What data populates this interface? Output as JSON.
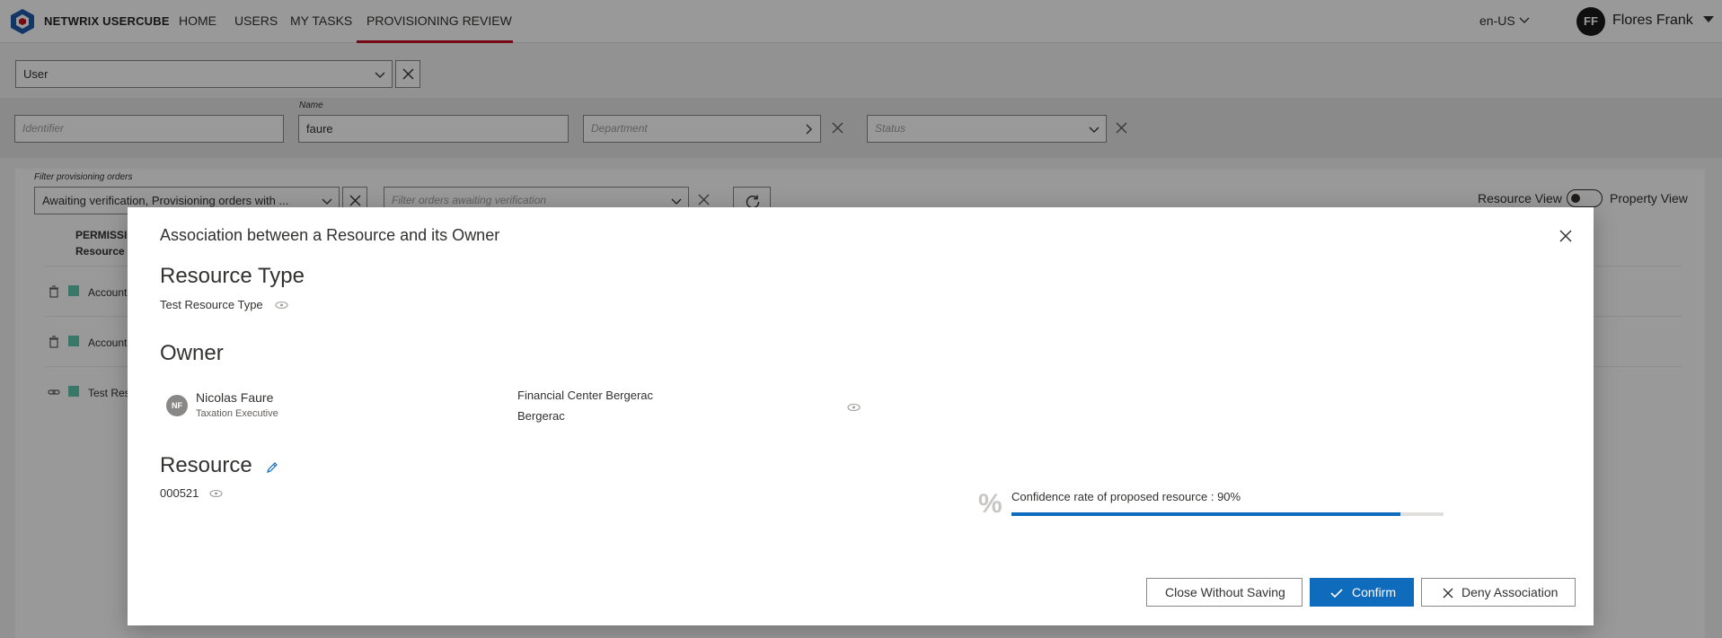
{
  "app": {
    "brand": "NETWRIX USERCUBE"
  },
  "nav": {
    "items": [
      "HOME",
      "USERS",
      "MY TASKS",
      "PROVISIONING REVIEW"
    ],
    "active": "PROVISIONING REVIEW",
    "accent_color": "#c50f1f"
  },
  "header": {
    "language": "en-US",
    "user_initials": "FF",
    "user_name": "Flores Frank"
  },
  "filters": {
    "entity_type": "User",
    "identifier_placeholder": "Identifier",
    "name_label": "Name",
    "name_value": "faure",
    "department_placeholder": "Department",
    "status_placeholder": "Status"
  },
  "orders": {
    "filter_label": "Filter provisioning orders",
    "filter_value": "Awaiting verification, Provisioning orders with ...",
    "awaiting_placeholder": "Filter orders awaiting verification",
    "resource_view": "Resource View",
    "property_view": "Property View",
    "column_header_line1": "PERMISSI",
    "column_header_line2": "Resource",
    "rows": [
      "Account",
      "Account",
      "Test Reso"
    ]
  },
  "modal": {
    "title": "Association between a Resource and its Owner",
    "resource_type_heading": "Resource Type",
    "resource_type_value": "Test Resource Type",
    "owner_heading": "Owner",
    "owner": {
      "initials": "NF",
      "name": "Nicolas Faure",
      "job_title": "Taxation Executive",
      "organization": "Financial Center Bergerac",
      "location": "Bergerac"
    },
    "resource_heading": "Resource",
    "resource_value": "000521",
    "confidence_label": "Confidence rate of proposed resource : 90%",
    "confidence_fraction": 0.9,
    "percent_symbol": "%",
    "buttons": {
      "close": "Close Without Saving",
      "confirm": "Confirm",
      "deny": "Deny Association"
    },
    "primary_color": "#0f6cbd"
  }
}
